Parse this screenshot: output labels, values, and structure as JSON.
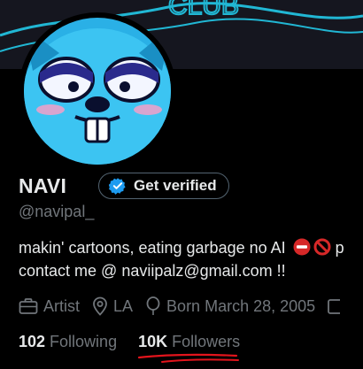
{
  "banner": {
    "text": "CLUB"
  },
  "profile": {
    "display_name": "NAVI",
    "handle": "@navipal_",
    "verify_label": "Get verified",
    "bio_line1": "makin' cartoons, eating garbage no AI",
    "bio_line1_tail": "p",
    "bio_line2": "contact me @ naviipalz@gmail.com !!",
    "category": "Artist",
    "location": "LA",
    "born": "Born March 28, 2005"
  },
  "stats": {
    "following_count": "102",
    "following_label": "Following",
    "followers_count": "10K",
    "followers_label": "Followers"
  },
  "colors": {
    "accent": "#1d9bf0",
    "annotation": "#e3141c",
    "avatar_blue": "#2ab0e6"
  },
  "icons": [
    "verified-badge-icon",
    "no-entry-emoji-icon",
    "prohibited-emoji-icon",
    "briefcase-icon",
    "location-pin-icon",
    "balloon-icon",
    "calendar-icon"
  ]
}
